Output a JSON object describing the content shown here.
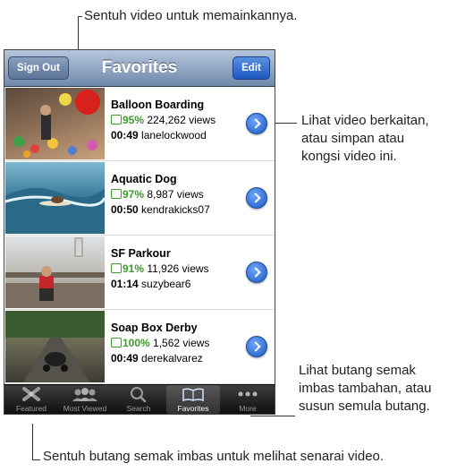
{
  "annotations": {
    "top": "Sentuh video untuk memainkannya.",
    "right_1": [
      "Lihat video berkaitan,",
      "atau simpan atau",
      "kongsi video ini."
    ],
    "right_2": [
      "Lihat butang semak",
      "imbas tambahan, atau",
      "susun semula butang."
    ],
    "bottom": "Sentuh butang semak imbas untuk melihat senarai video."
  },
  "navbar": {
    "title": "Favorites",
    "left_button": "Sign Out",
    "right_button": "Edit"
  },
  "videos": [
    {
      "title": "Balloon Boarding",
      "rating": "95%",
      "views": "224,262 views",
      "duration": "00:49",
      "user": "lanelockwood"
    },
    {
      "title": "Aquatic Dog",
      "rating": "97%",
      "views": "8,987 views",
      "duration": "00:50",
      "user": "kendrakicks07"
    },
    {
      "title": "SF Parkour",
      "rating": "91%",
      "views": "11,926 views",
      "duration": "01:14",
      "user": "suzybear6"
    },
    {
      "title": "Soap Box Derby",
      "rating": "100%",
      "views": "1,562 views",
      "duration": "00:49",
      "user": "derekalvarez"
    }
  ],
  "tabs": [
    {
      "label": "Featured",
      "icon": "featured-icon"
    },
    {
      "label": "Most Viewed",
      "icon": "most-viewed-icon"
    },
    {
      "label": "Search",
      "icon": "search-icon"
    },
    {
      "label": "Favorites",
      "icon": "favorites-icon",
      "selected": true
    },
    {
      "label": "More",
      "icon": "more-icon"
    }
  ],
  "colors": {
    "rating_green": "#3d9a2c",
    "tab_bar": "#1a1a1a",
    "disclosure_blue": "#1b5ac8"
  }
}
